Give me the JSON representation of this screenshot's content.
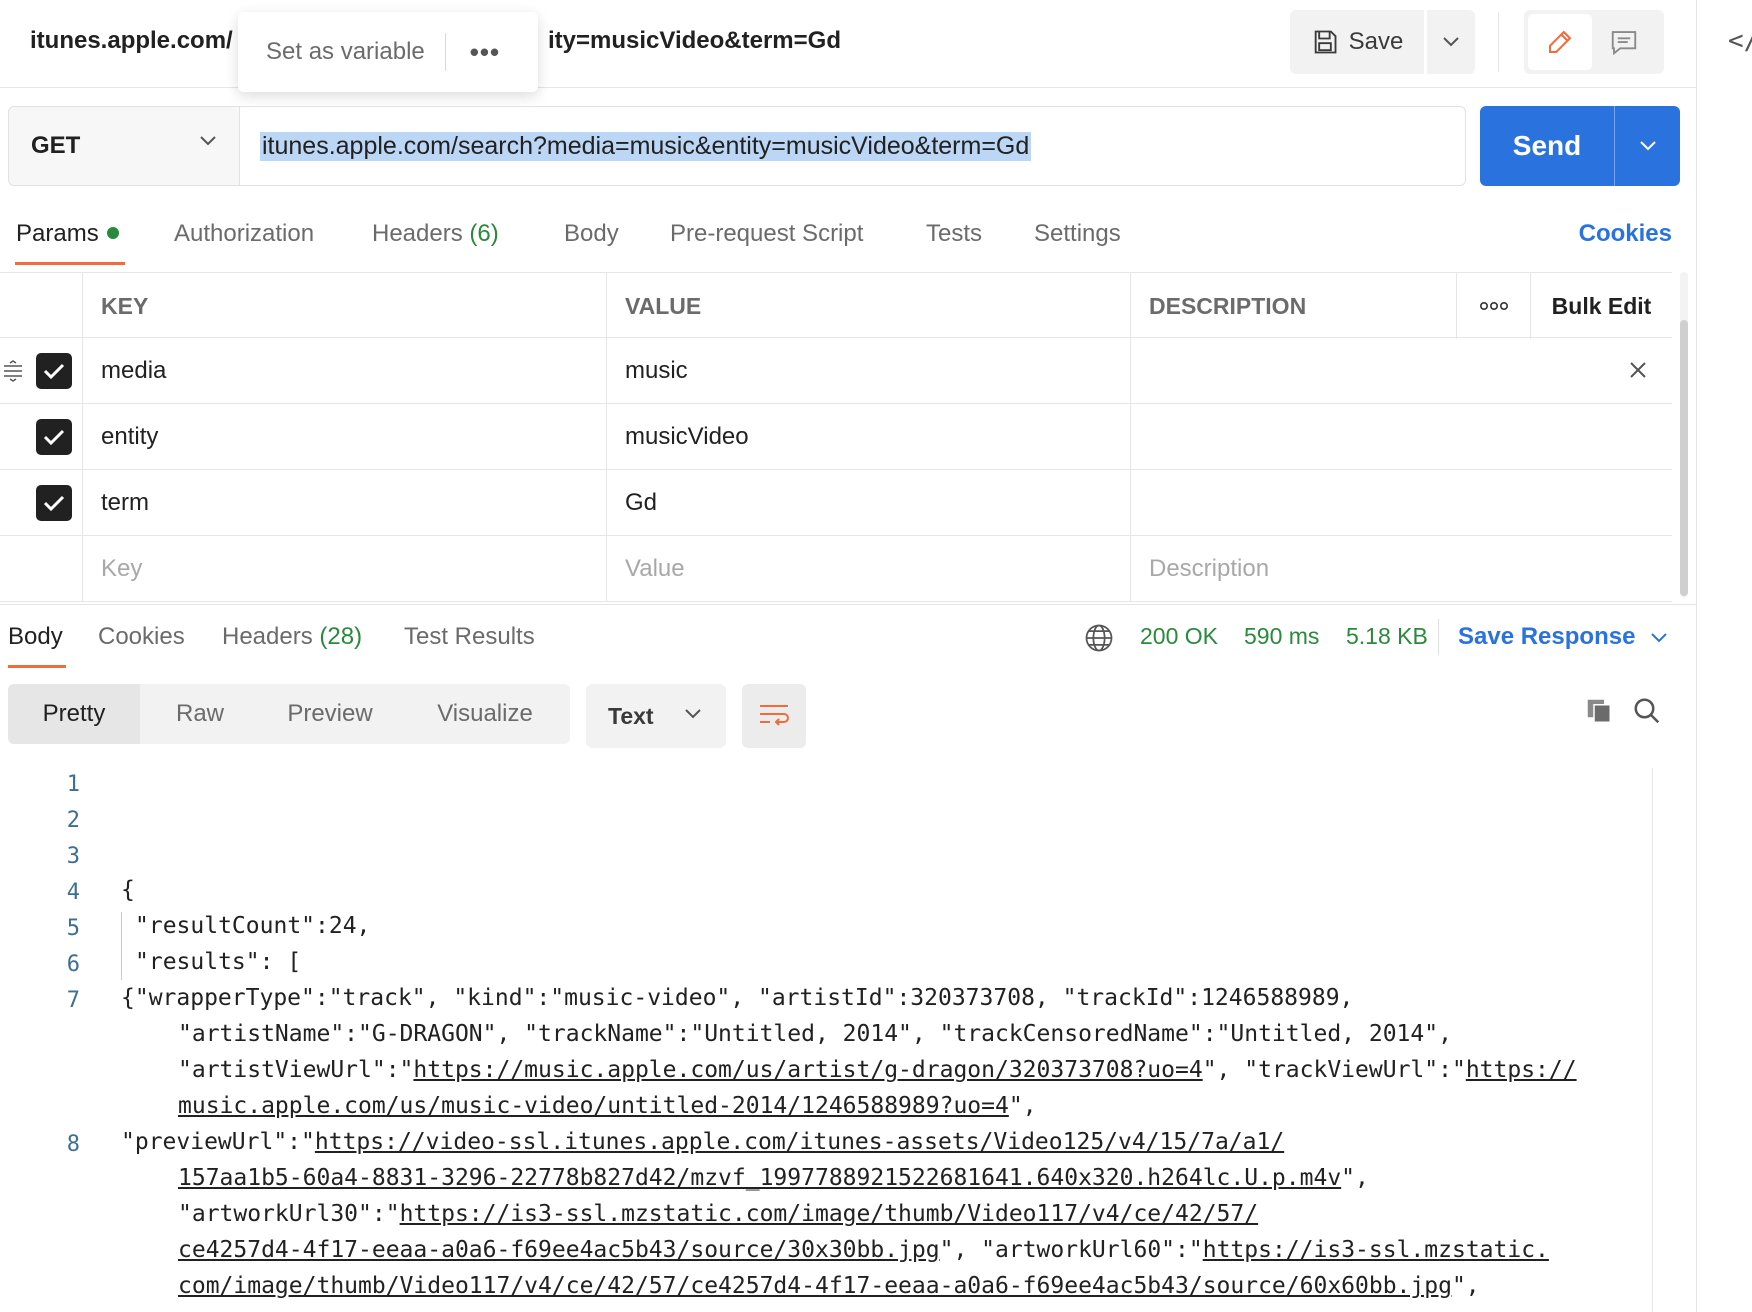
{
  "header": {
    "tab_title_left": "itunes.apple.com/",
    "tab_title_right": "ity=musicVideo&term=Gd",
    "popover_label": "Set as variable",
    "popover_more": "•••",
    "save_label": "Save"
  },
  "request": {
    "method": "GET",
    "url": "itunes.apple.com/search?media=music&entity=musicVideo&term=Gd",
    "send_label": "Send"
  },
  "req_tabs": {
    "params": "Params",
    "authorization": "Authorization",
    "headers": "Headers",
    "headers_count": "(6)",
    "body": "Body",
    "prerequest": "Pre-request Script",
    "tests": "Tests",
    "settings": "Settings",
    "cookies": "Cookies"
  },
  "params_table": {
    "col_key": "KEY",
    "col_value": "VALUE",
    "col_description": "DESCRIPTION",
    "more": "ooo",
    "bulk_edit": "Bulk Edit",
    "rows": [
      {
        "key": "media",
        "value": "music",
        "checked": true
      },
      {
        "key": "entity",
        "value": "musicVideo",
        "checked": true
      },
      {
        "key": "term",
        "value": "Gd",
        "checked": true
      }
    ],
    "placeholder_key": "Key",
    "placeholder_value": "Value",
    "placeholder_description": "Description"
  },
  "response": {
    "tab_body": "Body",
    "tab_cookies": "Cookies",
    "tab_headers": "Headers",
    "headers_count": "(28)",
    "tab_test_results": "Test Results",
    "status": "200 OK",
    "time": "590 ms",
    "size": "5.18 KB",
    "save_response": "Save Response",
    "views": [
      "Pretty",
      "Raw",
      "Preview",
      "Visualize"
    ],
    "format": "Text"
  },
  "code": {
    "line_numbers": [
      "1",
      "2",
      "3",
      "4",
      "5",
      "6",
      "7",
      "8"
    ],
    "l4": "{",
    "l5": "\"resultCount\":24,",
    "l6": "\"results\": [",
    "l7a": "{\"wrapperType\":\"track\", \"kind\":\"music-video\", \"artistId\":320373708, \"trackId\":1246588989,",
    "l7b": "\"artistName\":\"G-DRAGON\", \"trackName\":\"Untitled, 2014\", \"trackCensoredName\":\"Untitled, 2014\",",
    "l7c_pre": "\"artistViewUrl\":\"",
    "l7c_link": "https://music.apple.com/us/artist/g-dragon/320373708?uo=4",
    "l7c_mid": "\", \"trackViewUrl\":\"",
    "l7c_link2": "https://",
    "l7d_link": "music.apple.com/us/music-video/untitled-2014/1246588989?uo=4",
    "l7d_post": "\",",
    "l8a_pre": "\"previewUrl\":\"",
    "l8a_link": "https://video-ssl.itunes.apple.com/itunes-assets/Video125/v4/15/7a/a1/",
    "l8b_link": "157aa1b5-60a4-8831-3296-22778b827d42/mzvf_1997788921522681641.640x320.h264lc.U.p.m4v",
    "l8b_post": "\",",
    "l8c_pre": "\"artworkUrl30\":\"",
    "l8c_link": "https://is3-ssl.mzstatic.com/image/thumb/Video117/v4/ce/42/57/",
    "l8d_link": "ce4257d4-4f17-eeaa-a0a6-f69ee4ac5b43/source/30x30bb.jpg",
    "l8d_mid": "\", \"artworkUrl60\":\"",
    "l8d_link2": "https://is3-ssl.mzstatic.",
    "l8e_link": "com/image/thumb/Video117/v4/ce/42/57/ce4257d4-4f17-eeaa-a0a6-f69ee4ac5b43/source/60x60bb.jpg",
    "l8e_post": "\","
  },
  "colors": {
    "accent": "#2a73df",
    "tab_underline": "#f26b3a",
    "success": "#2a8a3c",
    "selection": "#bcd6f5"
  }
}
